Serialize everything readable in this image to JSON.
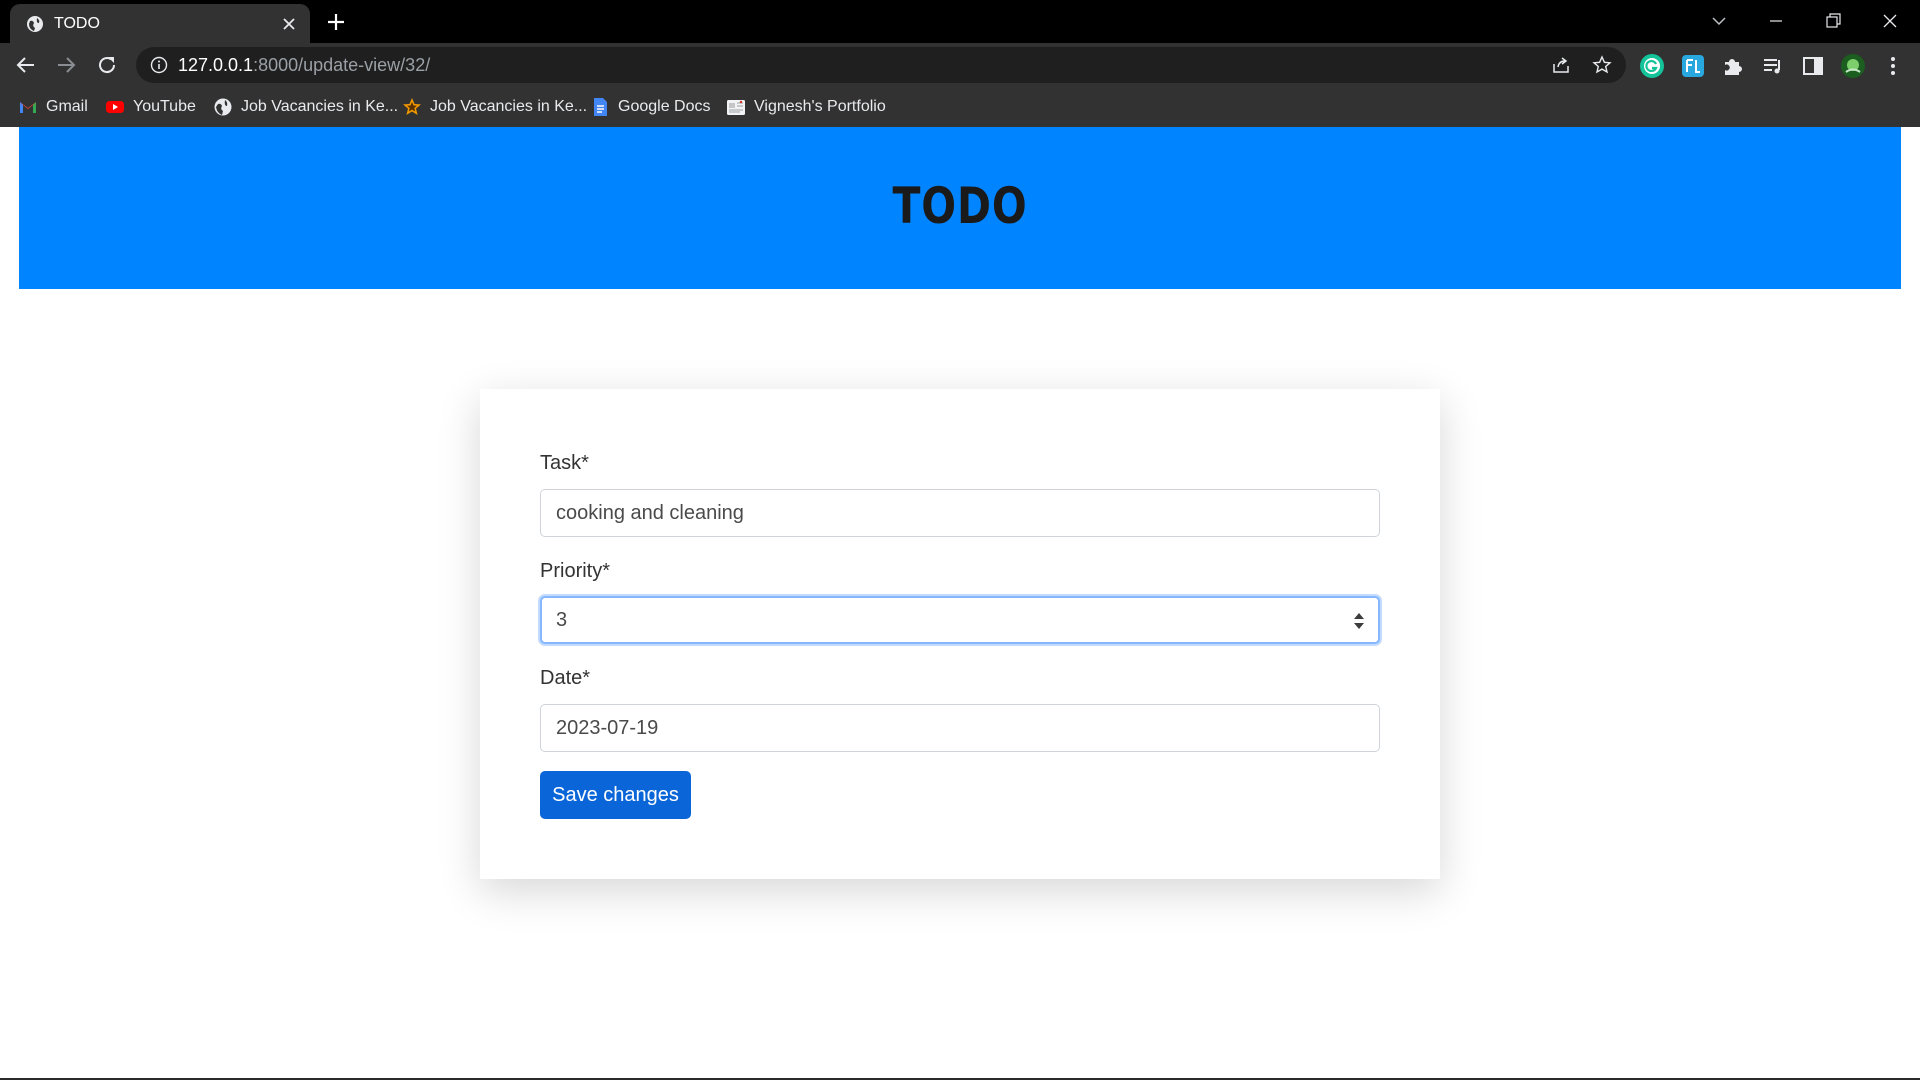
{
  "browser": {
    "tab": {
      "title": "TODO"
    },
    "address": {
      "host": "127.0.0.1",
      "path": ":8000/update-view/32/"
    },
    "bookmarks": [
      {
        "label": "Gmail",
        "icon": "gmail-icon"
      },
      {
        "label": "YouTube",
        "icon": "youtube-icon"
      },
      {
        "label": "Job Vacancies in Ke...",
        "icon": "globe-icon"
      },
      {
        "label": "Job Vacancies in Ke...",
        "icon": "star-icon"
      },
      {
        "label": "Google Docs",
        "icon": "docs-icon"
      },
      {
        "label": "Vignesh's Portfolio",
        "icon": "portfolio-icon"
      }
    ]
  },
  "page": {
    "title": "TODO",
    "header_color": "#0084ff"
  },
  "form": {
    "task": {
      "label": "Task*",
      "value": "cooking and cleaning"
    },
    "priority": {
      "label": "Priority*",
      "value": "3"
    },
    "date": {
      "label": "Date*",
      "value": "2023-07-19"
    },
    "submit_label": "Save changes",
    "accent": "#0a66d8"
  }
}
